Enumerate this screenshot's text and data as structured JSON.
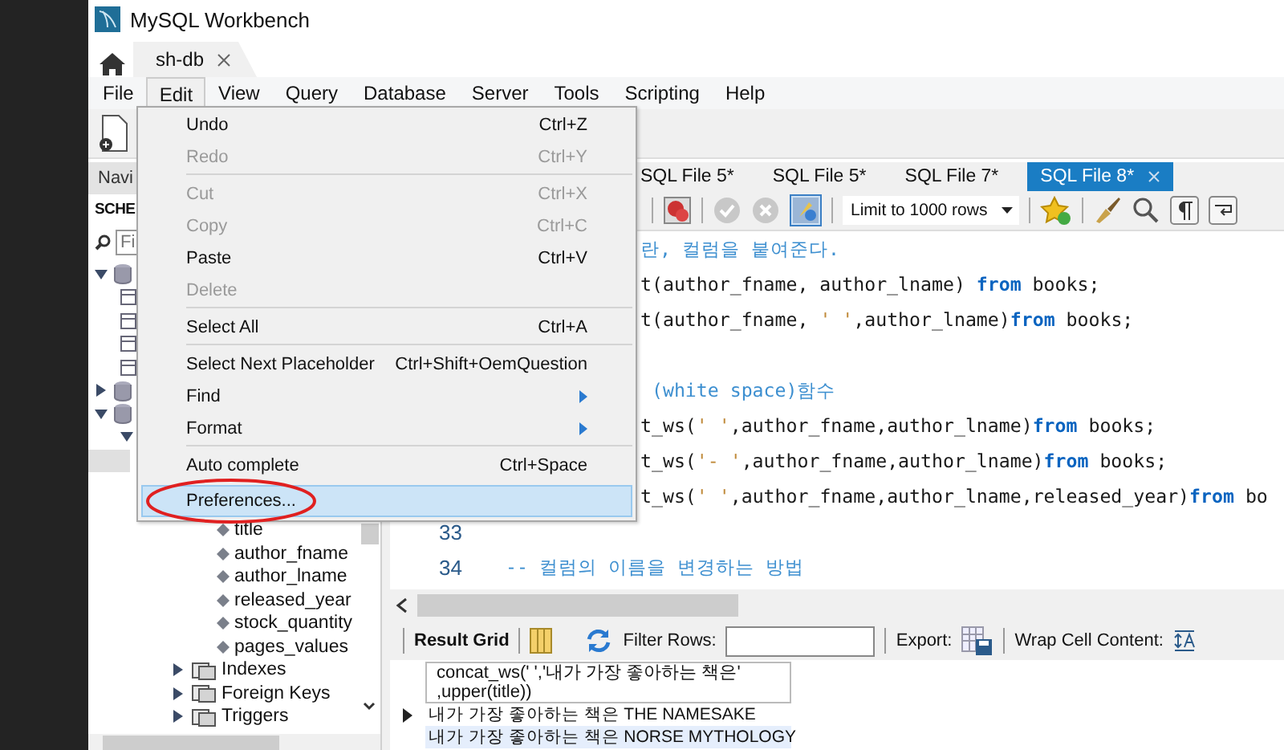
{
  "window": {
    "title": "MySQL Workbench"
  },
  "connection_tabs": [
    {
      "label": "sh-db",
      "selected": true
    }
  ],
  "menu_bar": [
    {
      "label": "File",
      "selected": false
    },
    {
      "label": "Edit",
      "selected": true
    },
    {
      "label": "View",
      "selected": false
    },
    {
      "label": "Query",
      "selected": false
    },
    {
      "label": "Database",
      "selected": false
    },
    {
      "label": "Server",
      "selected": false
    },
    {
      "label": "Tools",
      "selected": false
    },
    {
      "label": "Scripting",
      "selected": false
    },
    {
      "label": "Help",
      "selected": false
    }
  ],
  "edit_menu": [
    {
      "kind": "item",
      "label": "Undo",
      "shortcut": "Ctrl+Z",
      "disabled": false,
      "highlighted": false,
      "circled": false
    },
    {
      "kind": "item",
      "label": "Redo",
      "shortcut": "Ctrl+Y",
      "disabled": true,
      "highlighted": false,
      "circled": false
    },
    {
      "kind": "separator"
    },
    {
      "kind": "item",
      "label": "Cut",
      "shortcut": "Ctrl+X",
      "disabled": true,
      "highlighted": false,
      "circled": false
    },
    {
      "kind": "item",
      "label": "Copy",
      "shortcut": "Ctrl+C",
      "disabled": true,
      "highlighted": false,
      "circled": false
    },
    {
      "kind": "item",
      "label": "Paste",
      "shortcut": "Ctrl+V",
      "disabled": false,
      "highlighted": false,
      "circled": false
    },
    {
      "kind": "item",
      "label": "Delete",
      "disabled": true,
      "highlighted": false,
      "circled": false
    },
    {
      "kind": "separator"
    },
    {
      "kind": "item",
      "label": "Select All",
      "shortcut": "Ctrl+A",
      "disabled": false,
      "highlighted": false,
      "circled": false
    },
    {
      "kind": "separator"
    },
    {
      "kind": "item",
      "label": "Select Next Placeholder",
      "shortcut": "Ctrl+Shift+OemQuestion",
      "disabled": false,
      "highlighted": false,
      "circled": false
    },
    {
      "kind": "submenu",
      "label": "Find",
      "disabled": false,
      "highlighted": false,
      "circled": false
    },
    {
      "kind": "submenu",
      "label": "Format",
      "disabled": false,
      "highlighted": false,
      "circled": false
    },
    {
      "kind": "separator"
    },
    {
      "kind": "item",
      "label": "Auto complete",
      "shortcut": "Ctrl+Space",
      "disabled": false,
      "highlighted": false,
      "circled": false
    },
    {
      "kind": "item",
      "label": "Preferences...",
      "disabled": false,
      "highlighted": true,
      "circled": true
    }
  ],
  "navigator": {
    "header": "Navi",
    "schemas_label": "SCHE",
    "filter_placeholder": "Fi",
    "tree": [
      {
        "kind": "schema",
        "expanded": true,
        "selected": false,
        "children": [
          {
            "kind": "table",
            "selected": false
          },
          {
            "kind": "table",
            "selected": false
          },
          {
            "kind": "table",
            "selected": false
          },
          {
            "kind": "table",
            "selected": false
          }
        ]
      },
      {
        "kind": "schema",
        "expanded": false,
        "selected": false
      },
      {
        "kind": "schema",
        "expanded": true,
        "selected": false,
        "children": [
          {
            "expanded": true,
            "selected": false,
            "children": [
              {
                "selected": true,
                "children": [
                  {
                    "children": [
                      {
                        "kind": "column",
                        "label": "title",
                        "selected": false
                      },
                      {
                        "kind": "column",
                        "label": "author_fname",
                        "selected": false
                      },
                      {
                        "kind": "column",
                        "label": "author_lname",
                        "selected": false
                      },
                      {
                        "kind": "column",
                        "label": "released_year",
                        "selected": false
                      },
                      {
                        "kind": "column",
                        "label": "stock_quantity",
                        "selected": false
                      },
                      {
                        "kind": "column",
                        "label": "pages_values",
                        "selected": false
                      }
                    ]
                  },
                  {
                    "kind": "folder",
                    "label": "Indexes",
                    "expanded": false,
                    "selected": false
                  },
                  {
                    "kind": "folder",
                    "label": "Foreign Keys",
                    "expanded": false,
                    "selected": false
                  },
                  {
                    "kind": "folder",
                    "label": "Triggers",
                    "expanded": false,
                    "selected": false
                  }
                ]
              }
            ]
          }
        ]
      }
    ]
  },
  "editor": {
    "tabs": [
      {
        "label": "SQL File 5*",
        "selected": false
      },
      {
        "label": "SQL File 5*",
        "selected": false
      },
      {
        "label": "SQL File 7*",
        "selected": false
      },
      {
        "label": "SQL File 8*",
        "selected": true
      }
    ],
    "toggle": {
      "on": true
    },
    "limit": "Limit to 1000 rows",
    "lines": [
      {
        "kind": "covered",
        "tokens": [
          {
            "text": "란, 컬럼을 붙여준다.",
            "kind": "comment"
          }
        ]
      },
      {
        "kind": "covered",
        "tokens": [
          {
            "text": "t(author_fname, author_lname) ",
            "kind": "plain"
          },
          {
            "text": "from",
            "kind": "keyword"
          },
          {
            "text": " books;",
            "kind": "plain"
          }
        ]
      },
      {
        "kind": "covered",
        "tokens": [
          {
            "text": "t(author_fname, ",
            "kind": "plain"
          },
          {
            "text": "' '",
            "kind": "string"
          },
          {
            "text": ",author_lname)",
            "kind": "plain"
          },
          {
            "text": "from",
            "kind": "keyword"
          },
          {
            "text": " books;",
            "kind": "plain"
          }
        ]
      },
      {
        "kind": "blank"
      },
      {
        "kind": "covered",
        "tokens": [
          {
            "text": " (white space)함수",
            "kind": "comment"
          }
        ]
      },
      {
        "kind": "covered",
        "tokens": [
          {
            "text": "t_ws(",
            "kind": "plain"
          },
          {
            "text": "' '",
            "kind": "string"
          },
          {
            "text": ",author_fname,author_lname)",
            "kind": "plain"
          },
          {
            "text": "from",
            "kind": "keyword"
          },
          {
            "text": " books;",
            "kind": "plain"
          }
        ]
      },
      {
        "kind": "covered",
        "tokens": [
          {
            "text": "t_ws(",
            "kind": "plain"
          },
          {
            "text": "'- '",
            "kind": "string"
          },
          {
            "text": ",author_fname,author_lname)",
            "kind": "plain"
          },
          {
            "text": "from",
            "kind": "keyword"
          },
          {
            "text": " books;",
            "kind": "plain"
          }
        ]
      },
      {
        "kind": "covered",
        "tokens": [
          {
            "text": "t_ws(",
            "kind": "plain"
          },
          {
            "text": "' '",
            "kind": "string"
          },
          {
            "text": ",author_fname,author_lname,released_year)",
            "kind": "plain"
          },
          {
            "text": "from",
            "kind": "keyword"
          },
          {
            "text": " bo",
            "kind": "plain"
          }
        ]
      },
      {
        "kind": "numbered",
        "number": "33"
      },
      {
        "kind": "numbered",
        "number": "34",
        "tokens": [
          {
            "text": "  -- 컬럼의 이름을 변경하는 방법",
            "kind": "comment"
          }
        ]
      }
    ]
  },
  "results": {
    "title": "Result Grid",
    "filter_label": "Filter Rows:",
    "export_label": "Export:",
    "wrap_label": "Wrap Cell Content:",
    "header_lines": [
      "concat_ws(' ','내가 가장 좋아하는 책은'",
      ",upper(title))"
    ],
    "rows": [
      {
        "cell": "내가 가장 좋아하는 책은 THE NAMESAKE",
        "current": true,
        "selected": false
      },
      {
        "cell": "내가 가장 좋아하는 책은 NORSE MYTHOLOGY",
        "current": false,
        "selected": true
      }
    ]
  }
}
